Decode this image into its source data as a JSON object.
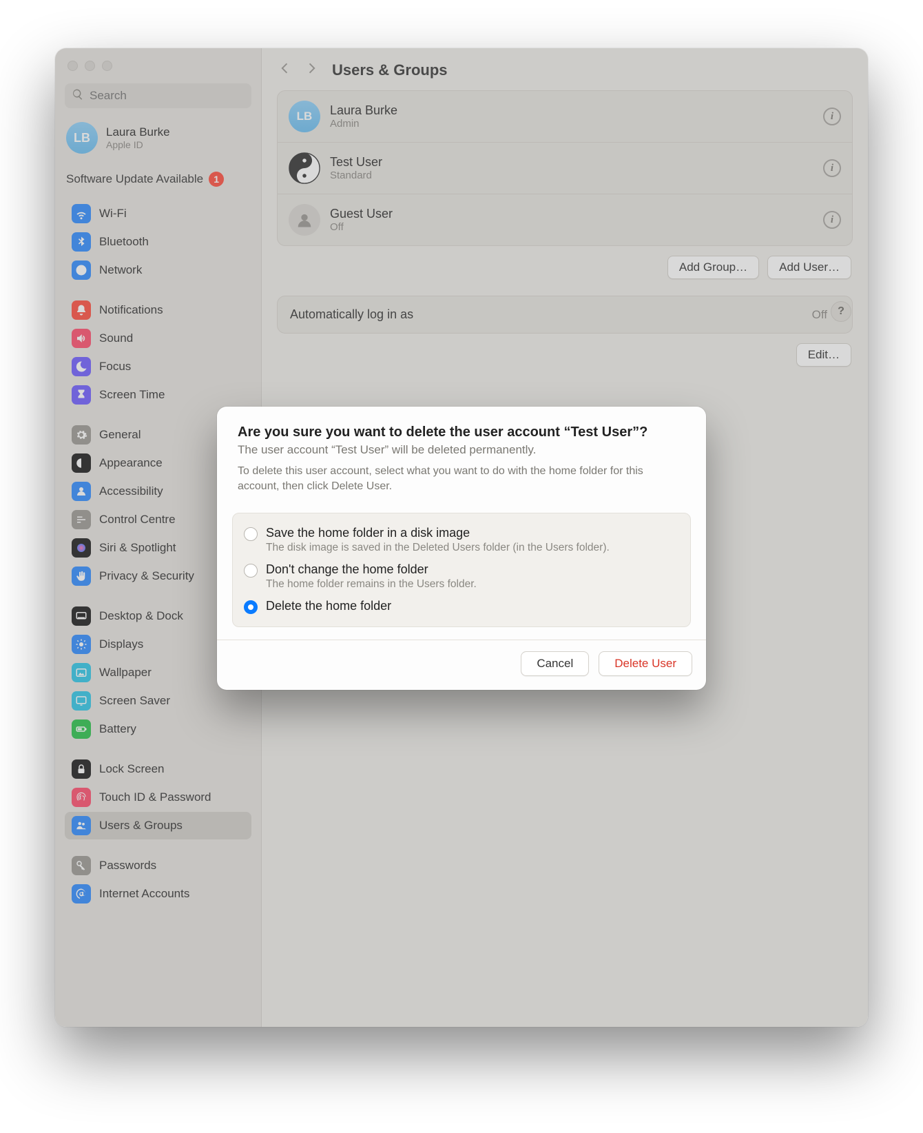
{
  "window": {
    "title": "Users & Groups"
  },
  "search": {
    "placeholder": "Search"
  },
  "account": {
    "initials": "LB",
    "name": "Laura Burke",
    "sub": "Apple ID"
  },
  "software_update": {
    "label": "Software Update Available",
    "count": "1"
  },
  "sidebar_groups": [
    {
      "items": [
        {
          "id": "wifi",
          "label": "Wi-Fi",
          "color": "#2e8bff",
          "icon": "wifi"
        },
        {
          "id": "bluetooth",
          "label": "Bluetooth",
          "color": "#2e8bff",
          "icon": "bluetooth"
        },
        {
          "id": "network",
          "label": "Network",
          "color": "#2e8bff",
          "icon": "globe"
        }
      ]
    },
    {
      "items": [
        {
          "id": "notifications",
          "label": "Notifications",
          "color": "#ff4d3d",
          "icon": "bell"
        },
        {
          "id": "sound",
          "label": "Sound",
          "color": "#ff4d6d",
          "icon": "speaker"
        },
        {
          "id": "focus",
          "label": "Focus",
          "color": "#6e5cff",
          "icon": "moon"
        },
        {
          "id": "screentime",
          "label": "Screen Time",
          "color": "#6e5cff",
          "icon": "hourglass"
        }
      ]
    },
    {
      "items": [
        {
          "id": "general",
          "label": "General",
          "color": "#9b9994",
          "icon": "gear"
        },
        {
          "id": "appearance",
          "label": "Appearance",
          "color": "#1b1b1b",
          "icon": "appearance"
        },
        {
          "id": "accessibility",
          "label": "Accessibility",
          "color": "#2e8bff",
          "icon": "person"
        },
        {
          "id": "controlcentre",
          "label": "Control Centre",
          "color": "#9b9994",
          "icon": "sliders"
        },
        {
          "id": "siri",
          "label": "Siri & Spotlight",
          "color": "#1b1b1b",
          "icon": "siri"
        },
        {
          "id": "privacy",
          "label": "Privacy & Security",
          "color": "#2e8bff",
          "icon": "hand"
        }
      ]
    },
    {
      "items": [
        {
          "id": "desktopdock",
          "label": "Desktop & Dock",
          "color": "#1b1b1b",
          "icon": "dock"
        },
        {
          "id": "displays",
          "label": "Displays",
          "color": "#2e8bff",
          "icon": "sun"
        },
        {
          "id": "wallpaper",
          "label": "Wallpaper",
          "color": "#2fc6e8",
          "icon": "picture"
        },
        {
          "id": "screensaver",
          "label": "Screen Saver",
          "color": "#2fc6e8",
          "icon": "screensaver"
        },
        {
          "id": "battery",
          "label": "Battery",
          "color": "#29c24a",
          "icon": "battery"
        }
      ]
    },
    {
      "items": [
        {
          "id": "lockscreen",
          "label": "Lock Screen",
          "color": "#1b1b1b",
          "icon": "lock"
        },
        {
          "id": "touchid",
          "label": "Touch ID & Password",
          "color": "#ff4d6d",
          "icon": "fingerprint"
        },
        {
          "id": "usersgroups",
          "label": "Users & Groups",
          "color": "#2e8bff",
          "icon": "people",
          "selected": true
        }
      ]
    },
    {
      "items": [
        {
          "id": "passwords",
          "label": "Passwords",
          "color": "#9b9994",
          "icon": "key"
        },
        {
          "id": "internetaccounts",
          "label": "Internet Accounts",
          "color": "#2e8bff",
          "icon": "at"
        }
      ]
    }
  ],
  "users": [
    {
      "name": "Laura Burke",
      "role": "Admin",
      "avatar": "initials",
      "initials": "LB",
      "bg": "linear-gradient(180deg,#8fd0f8,#6bbef1)"
    },
    {
      "name": "Test User",
      "role": "Standard",
      "avatar": "yinyang"
    },
    {
      "name": "Guest User",
      "role": "Off",
      "avatar": "silhouette"
    }
  ],
  "buttons": {
    "add_group": "Add Group…",
    "add_user": "Add User…",
    "edit": "Edit…"
  },
  "auto_login": {
    "label": "Automatically log in as",
    "value": "Off"
  },
  "help": {
    "label": "?"
  },
  "modal": {
    "title": "Are you sure you want to delete the user account “Test User”?",
    "sub1": "The user account “Test User” will be deleted permanently.",
    "sub2": "To delete this user account, select what you want to do with the home folder for this account, then click Delete User.",
    "options": [
      {
        "label": "Save the home folder in a disk image",
        "desc": "The disk image is saved in the Deleted Users folder (in the Users folder).",
        "selected": false
      },
      {
        "label": "Don't change the home folder",
        "desc": "The home folder remains in the Users folder.",
        "selected": false
      },
      {
        "label": "Delete the home folder",
        "desc": "",
        "selected": true
      }
    ],
    "cancel": "Cancel",
    "delete": "Delete User"
  }
}
